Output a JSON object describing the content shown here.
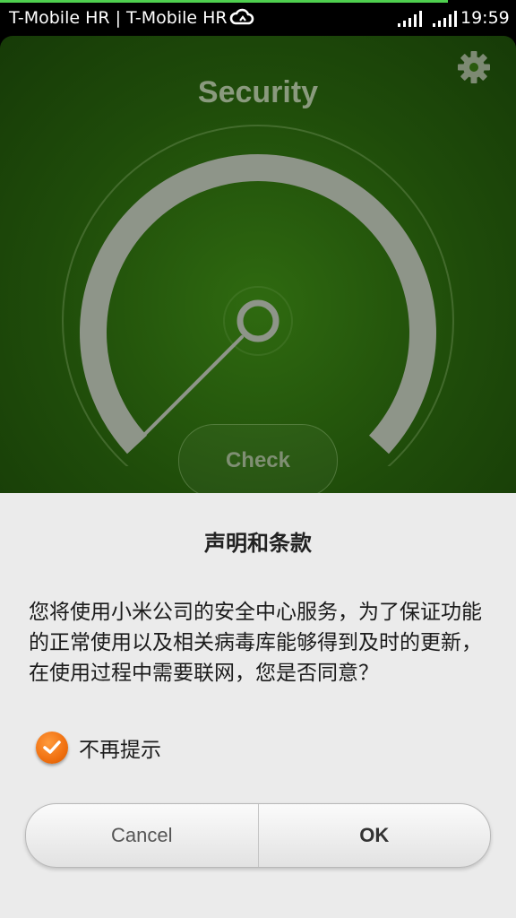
{
  "status_bar": {
    "carrier": "T-Mobile HR | T-Mobile HR",
    "time": "19:59",
    "icons": [
      "cloud-icon",
      "signal-icon",
      "signal-icon"
    ],
    "progress_color": "#4fd04f"
  },
  "app": {
    "title": "Security",
    "settings_icon": "gear-icon",
    "check_label": "Check",
    "accent_color": "#2f6a10"
  },
  "dialog": {
    "title": "声明和条款",
    "message": "您将使用小米公司的安全中心服务，为了保证功能的正常使用以及相关病毒库能够得到及时的更新，在使用过程中需要联网，您是否同意？",
    "checkbox_label": "不再提示",
    "checkbox_checked": true,
    "checkbox_color": "#f07010",
    "cancel_label": "Cancel",
    "ok_label": "OK"
  }
}
